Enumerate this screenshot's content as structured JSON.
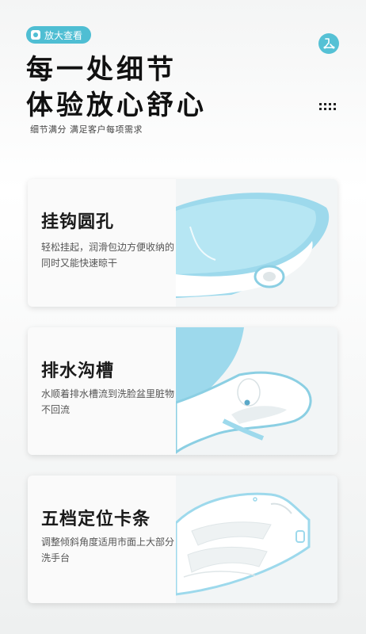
{
  "badge": {
    "label": "放大查看",
    "icon": "zoom-icon"
  },
  "corner_icon": "hanger-icon",
  "title": "每一处细节\n体验放心舒心",
  "subtitle": "细节满分 满足客户每项需求",
  "colors": {
    "accent": "#4fbed3",
    "product_blue": "#8cd3e8"
  },
  "features": [
    {
      "title": "挂钩圆孔",
      "desc": "轻松挂起，润滑包边方便收纳的同时又能快速晾干"
    },
    {
      "title": "排水沟槽",
      "desc": "水顺着排水槽流到洗脸盆里脏物不回流"
    },
    {
      "title": "五档定位卡条",
      "desc": "调整倾斜角度适用市面上大部分洗手台"
    }
  ]
}
